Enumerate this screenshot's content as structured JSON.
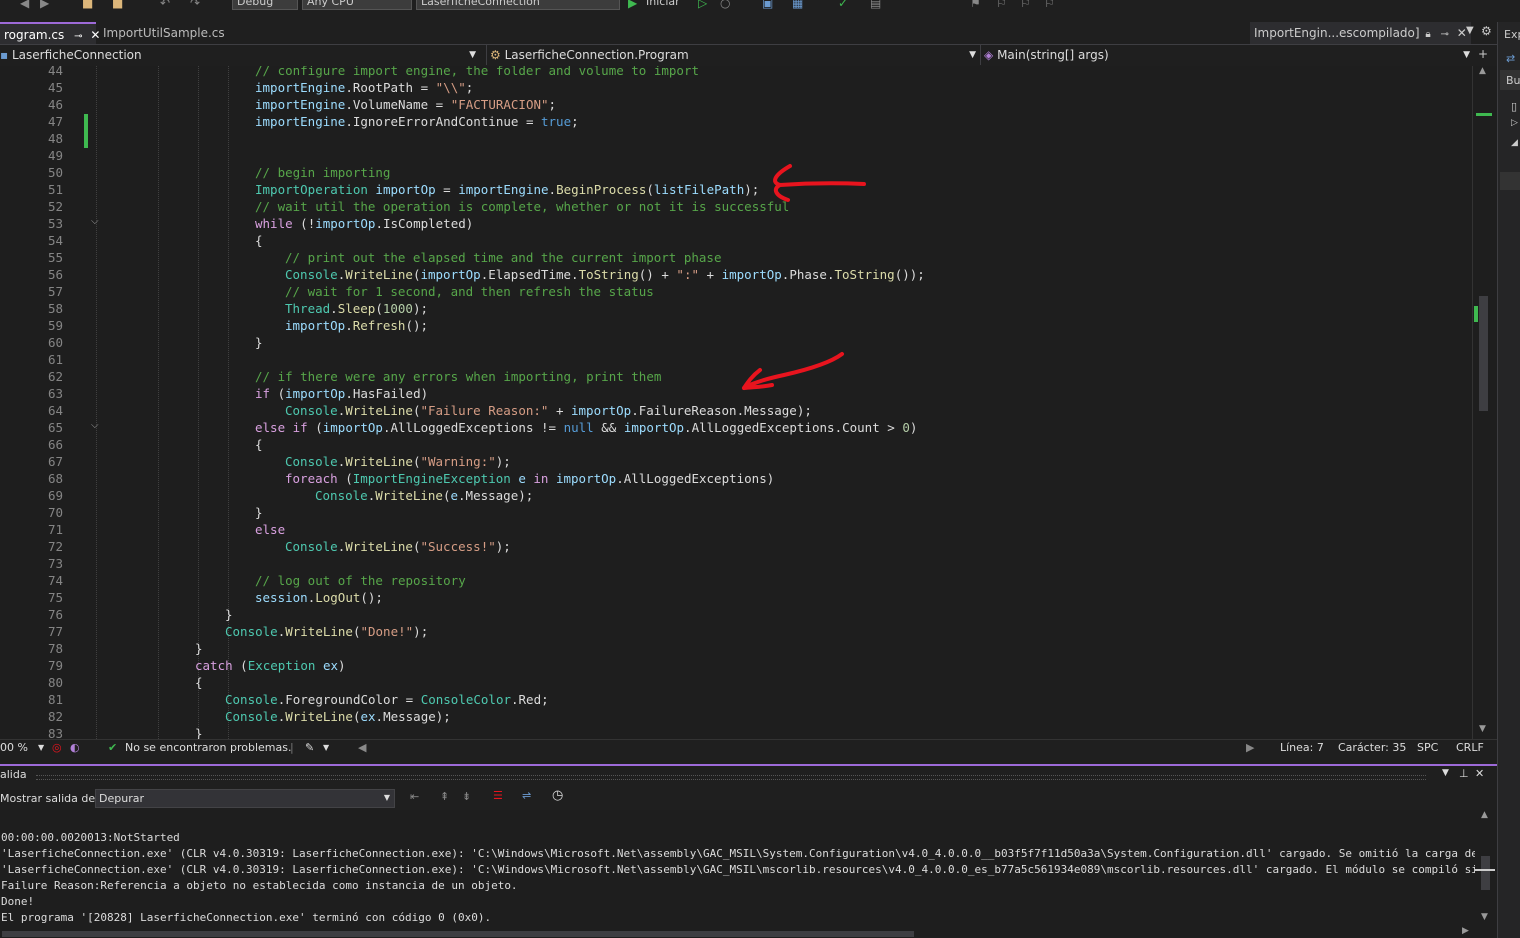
{
  "toolbar": {
    "config_value": "Debug",
    "platform_value": "Any CPU",
    "startup_value": "LaserficheConnection",
    "start_label": "Iniciar"
  },
  "tabs": [
    {
      "label": "rogram.cs"
    },
    {
      "label": "ImportUtilSample.cs"
    }
  ],
  "tab_right_label": "ImportEngin...escompilado]",
  "nav": {
    "project": "LaserficheConnection",
    "class": "LaserficheConnection.Program",
    "member": "Main(string[] args)"
  },
  "code_lines": [
    {
      "n": "44",
      "html": "<span class=\"c\">// configure import engine, the folder and volume to import</span>",
      "ind": 0
    },
    {
      "n": "45",
      "html": "<span class=\"v\">importEngine</span>.<span class=\"p\">RootPath</span> = <span class=\"s\">\"\\\\\"</span>;",
      "ind": 0
    },
    {
      "n": "46",
      "html": "<span class=\"v\">importEngine</span>.<span class=\"p\">VolumeName</span> = <span class=\"s\">\"FACTURACION\"</span>;",
      "ind": 0
    },
    {
      "n": "47",
      "html": "<span class=\"v\">importEngine</span>.<span class=\"p\">IgnoreErrorAndContinue</span> = <span class=\"k\">true</span>;",
      "ind": 0
    },
    {
      "n": "48",
      "html": "",
      "ind": 0
    },
    {
      "n": "49",
      "html": "",
      "ind": 0
    },
    {
      "n": "50",
      "html": "<span class=\"c\">// begin importing</span>",
      "ind": 0
    },
    {
      "n": "51",
      "html": "<span class=\"t\">ImportOperation</span> <span class=\"v\">importOp</span> = <span class=\"v\">importEngine</span>.<span class=\"m\">BeginProcess</span>(<span class=\"v\">listFilePath</span>);",
      "ind": 0
    },
    {
      "n": "52",
      "html": "<span class=\"c\">// wait util the operation is complete, whether or not it is successful</span>",
      "ind": 0
    },
    {
      "n": "53",
      "html": "<span class=\"kc\">while</span> (!<span class=\"v\">importOp</span>.<span class=\"p\">IsCompleted</span>)",
      "ind": 0
    },
    {
      "n": "54",
      "html": "{",
      "ind": 0
    },
    {
      "n": "55",
      "html": "<span class=\"c\">// print out the elapsed time and the current import phase</span>",
      "ind": 1
    },
    {
      "n": "56",
      "html": "<span class=\"t\">Console</span>.<span class=\"m\">WriteLine</span>(<span class=\"v\">importOp</span>.<span class=\"p\">ElapsedTime</span>.<span class=\"m\">ToString</span>() + <span class=\"s\">\":\"</span> + <span class=\"v\">importOp</span>.<span class=\"p\">Phase</span>.<span class=\"m\">ToString</span>());",
      "ind": 1
    },
    {
      "n": "57",
      "html": "<span class=\"c\">// wait for 1 second, and then refresh the status</span>",
      "ind": 1
    },
    {
      "n": "58",
      "html": "<span class=\"t\">Thread</span>.<span class=\"m\">Sleep</span>(<span class=\"n\">1000</span>);",
      "ind": 1
    },
    {
      "n": "59",
      "html": "<span class=\"v\">importOp</span>.<span class=\"m\">Refresh</span>();",
      "ind": 1
    },
    {
      "n": "60",
      "html": "}",
      "ind": 0
    },
    {
      "n": "61",
      "html": "",
      "ind": 0
    },
    {
      "n": "62",
      "html": "<span class=\"c\">// if there were any errors when importing, print them</span>",
      "ind": 0
    },
    {
      "n": "63",
      "html": "<span class=\"kc\">if</span> (<span class=\"v\">importOp</span>.<span class=\"p\">HasFailed</span>)",
      "ind": 0
    },
    {
      "n": "64",
      "html": "<span class=\"t\">Console</span>.<span class=\"m\">WriteLine</span>(<span class=\"s\">\"Failure Reason:\"</span> + <span class=\"v\">importOp</span>.<span class=\"p\">FailureReason</span>.<span class=\"p\">Message</span>);",
      "ind": 1
    },
    {
      "n": "65",
      "html": "<span class=\"kc\">else if</span> (<span class=\"v\">importOp</span>.<span class=\"p\">AllLoggedExceptions</span> != <span class=\"k\">null</span> &amp;&amp; <span class=\"v\">importOp</span>.<span class=\"p\">AllLoggedExceptions</span>.<span class=\"p\">Count</span> &gt; <span class=\"n\">0</span>)",
      "ind": 0
    },
    {
      "n": "66",
      "html": "{",
      "ind": 0
    },
    {
      "n": "67",
      "html": "<span class=\"t\">Console</span>.<span class=\"m\">WriteLine</span>(<span class=\"s\">\"Warning:\"</span>);",
      "ind": 1
    },
    {
      "n": "68",
      "html": "<span class=\"kc\">foreach</span> (<span class=\"t\">ImportEngineException</span> <span class=\"v\">e</span> <span class=\"kc\">in</span> <span class=\"v\">importOp</span>.<span class=\"p\">AllLoggedExceptions</span>)",
      "ind": 1
    },
    {
      "n": "69",
      "html": "<span class=\"t\">Console</span>.<span class=\"m\">WriteLine</span>(<span class=\"v\">e</span>.<span class=\"p\">Message</span>);",
      "ind": 2
    },
    {
      "n": "70",
      "html": "}",
      "ind": 0
    },
    {
      "n": "71",
      "html": "<span class=\"kc\">else</span>",
      "ind": 0
    },
    {
      "n": "72",
      "html": "<span class=\"t\">Console</span>.<span class=\"m\">WriteLine</span>(<span class=\"s\">\"Success!\"</span>);",
      "ind": 1
    },
    {
      "n": "73",
      "html": "",
      "ind": 0
    },
    {
      "n": "74",
      "html": "<span class=\"c\">// log out of the repository</span>",
      "ind": 0
    },
    {
      "n": "75",
      "html": "<span class=\"v\">session</span>.<span class=\"m\">LogOut</span>();",
      "ind": 0
    },
    {
      "n": "76",
      "html": "}",
      "ind": -1
    },
    {
      "n": "77",
      "html": "<span class=\"t\">Console</span>.<span class=\"m\">WriteLine</span>(<span class=\"s\">\"Done!\"</span>);",
      "ind": -1
    },
    {
      "n": "78",
      "html": "}",
      "ind": -2
    },
    {
      "n": "79",
      "html": "<span class=\"kc\">catch</span> (<span class=\"t\">Exception</span> <span class=\"v\">ex</span>)",
      "ind": -2
    },
    {
      "n": "80",
      "html": "{",
      "ind": -2
    },
    {
      "n": "81",
      "html": "<span class=\"t\">Console</span>.<span class=\"p\">ForegroundColor</span> = <span class=\"t\">ConsoleColor</span>.<span class=\"p\">Red</span>;",
      "ind": -1
    },
    {
      "n": "82",
      "html": "<span class=\"t\">Console</span>.<span class=\"m\">WriteLine</span>(<span class=\"v\">ex</span>.<span class=\"p\">Message</span>);",
      "ind": -1
    },
    {
      "n": "83",
      "html": "}",
      "ind": -2
    }
  ],
  "status": {
    "zoom": "00 %",
    "problems": "No se encontraron problemas.",
    "line": "Línea: 7",
    "char": "Carácter: 35",
    "spc": "SPC",
    "eol": "CRLF"
  },
  "output": {
    "title": "alida",
    "show_label": "Mostrar salida de:",
    "source": "Depurar",
    "lines": [
      "00:00:00.0020013:NotStarted",
      "'LaserficheConnection.exe' (CLR v4.0.30319: LaserficheConnection.exe): 'C:\\Windows\\Microsoft.Net\\assembly\\GAC_MSIL\\System.Configuration\\v4.0_4.0.0.0__b03f5f7f11d50a3a\\System.Configuration.dll' cargado. Se omitió la carga de símbol",
      "'LaserficheConnection.exe' (CLR v4.0.30319: LaserficheConnection.exe): 'C:\\Windows\\Microsoft.Net\\assembly\\GAC_MSIL\\mscorlib.resources\\v4.0_4.0.0.0_es_b77a5c561934e089\\mscorlib.resources.dll' cargado. El módulo se compiló sin símbo",
      "Failure Reason:Referencia a objeto no establecida como instancia de un objeto.",
      "Done!",
      "El programa '[20828] LaserficheConnection.exe' terminó con código 0 (0x0)."
    ]
  },
  "right_panel": {
    "exp": "Exp",
    "bu": "Bu"
  },
  "colors": {
    "accent": "#9d6ad8",
    "annotation": "#e8141e",
    "ok": "#3fb950"
  }
}
